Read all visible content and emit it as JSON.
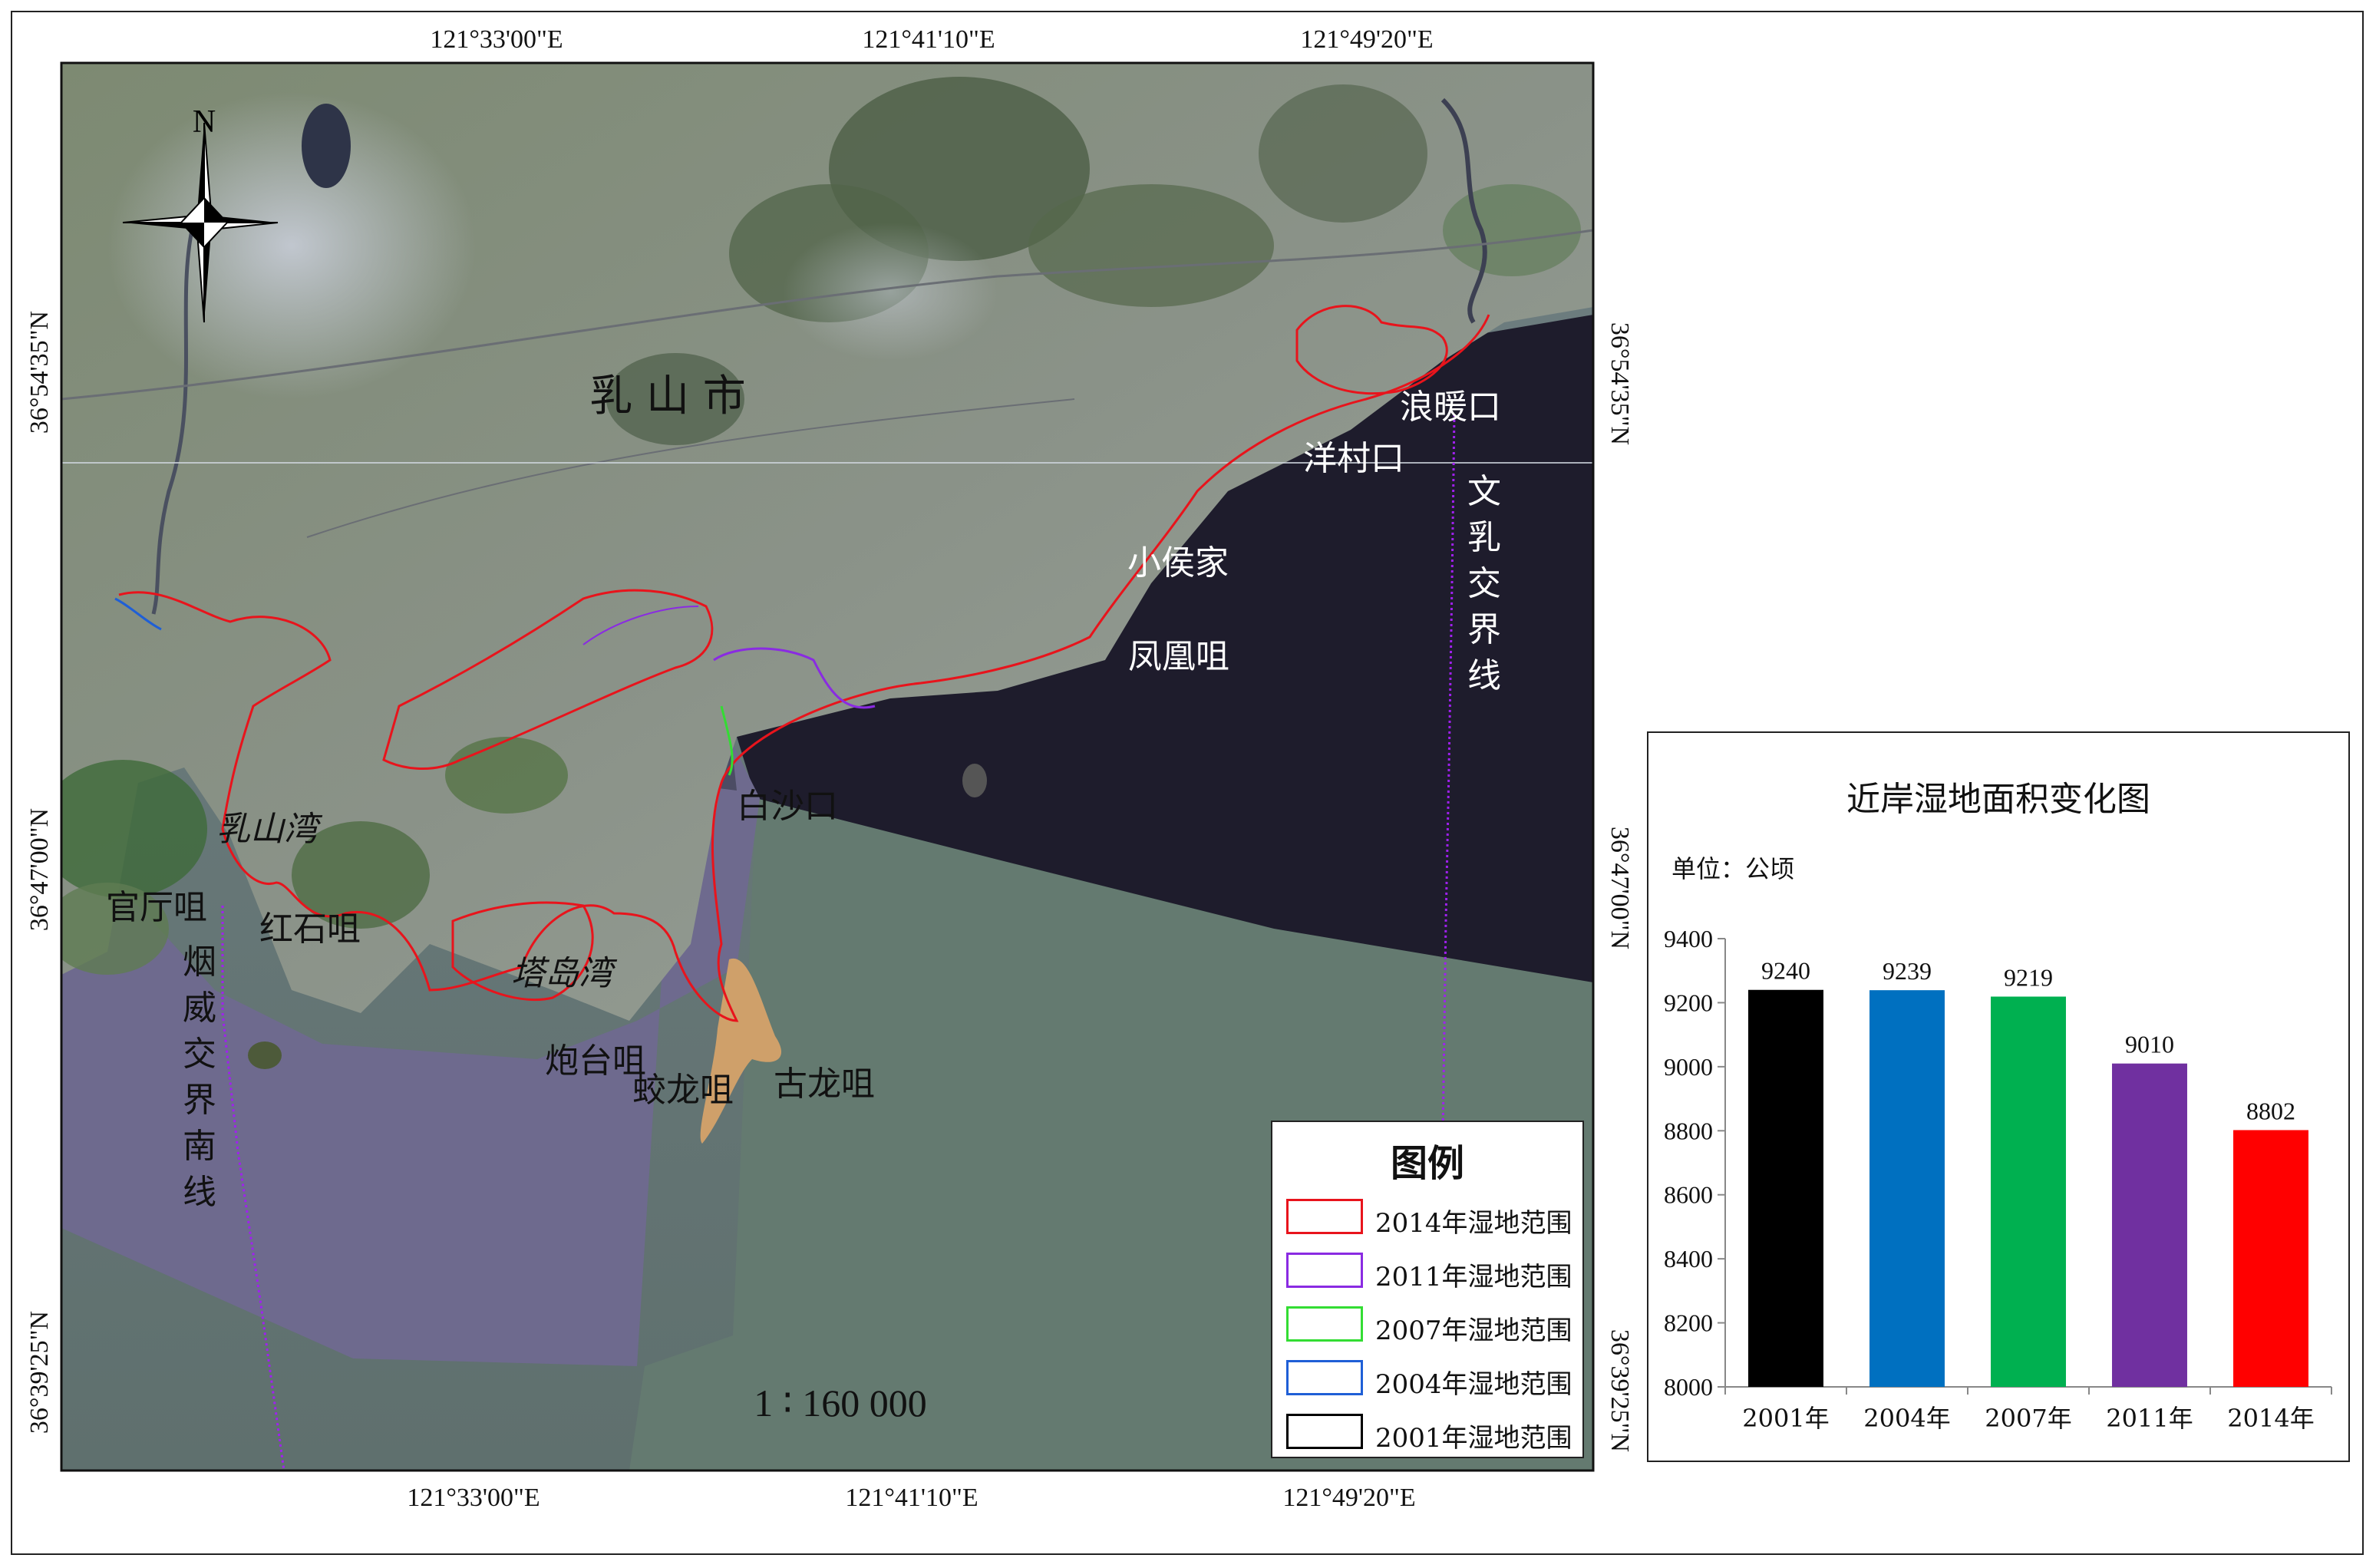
{
  "map": {
    "city_label": "乳 山 市",
    "scale": "1 ∶ 160 000",
    "north_label": "N",
    "coords": {
      "top_lon": [
        "121°33'00\"E",
        "121°41'10\"E",
        "121°49'20\"E"
      ],
      "bottom_lon": [
        "121°33'00\"E",
        "121°41'10\"E",
        "121°49'20\"E"
      ],
      "left_lat": [
        "36°54'35\"N",
        "36°47'00\"N",
        "36°39'25\"N"
      ],
      "right_lat": [
        "36°54'35\"N",
        "36°47'00\"N",
        "36°39'25\"N"
      ]
    },
    "place_labels": [
      {
        "id": "langnuankou",
        "text": "浪暖口"
      },
      {
        "id": "yangcunkou",
        "text": "洋村口"
      },
      {
        "id": "xiaohoujia",
        "text": "小侯家"
      },
      {
        "id": "fenghuangzui",
        "text": "凤凰咀"
      },
      {
        "id": "baishakou",
        "text": "白沙口"
      },
      {
        "id": "rushanwan",
        "text": "乳山湾"
      },
      {
        "id": "guantingzui",
        "text": "官厅咀"
      },
      {
        "id": "hongshizui",
        "text": "红石咀"
      },
      {
        "id": "tadaowan",
        "text": "塔岛湾"
      },
      {
        "id": "paotaizui",
        "text": "炮台咀"
      },
      {
        "id": "jiaolongzui",
        "text": "蛟龙咀"
      },
      {
        "id": "gulongzui",
        "text": "古龙咀"
      }
    ],
    "vertical_labels": [
      {
        "id": "wenru-boundary",
        "text": "文乳交界线"
      },
      {
        "id": "yanwei-boundary",
        "text": "烟威交界南线"
      }
    ]
  },
  "legend": {
    "title": "图例",
    "items": [
      {
        "label": "2014年湿地范围",
        "color": "#e8141c"
      },
      {
        "label": "2011年湿地范围",
        "color": "#8a2be2"
      },
      {
        "label": "2007年湿地范围",
        "color": "#33dd33"
      },
      {
        "label": "2004年湿地范围",
        "color": "#1f5fd6"
      },
      {
        "label": "2001年湿地范围",
        "color": "#000000"
      }
    ]
  },
  "chart": {
    "title": "近岸湿地面积变化图",
    "unit": "单位：公顷"
  },
  "chart_data": {
    "type": "bar",
    "title": "近岸湿地面积变化图",
    "ylabel": "单位：公顷",
    "categories": [
      "2001年",
      "2004年",
      "2007年",
      "2011年",
      "2014年"
    ],
    "values": [
      9240,
      9239,
      9219,
      9010,
      8802
    ],
    "colors": [
      "#000000",
      "#0070c0",
      "#00b050",
      "#7030a0",
      "#ff0000"
    ],
    "ylim": [
      8000,
      9400
    ],
    "yticks": [
      8000,
      8200,
      8400,
      8600,
      8800,
      9000,
      9200,
      9400
    ],
    "data_labels": true,
    "grid": false
  }
}
